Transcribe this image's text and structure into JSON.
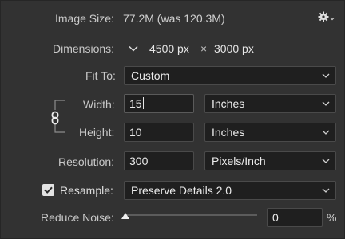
{
  "image_size": {
    "label": "Image Size:",
    "value": "77.2M (was 120.3M)"
  },
  "gear": {
    "icon": "gear-icon"
  },
  "dimensions": {
    "label": "Dimensions:",
    "width": "4500 px",
    "times": "×",
    "height": "3000 px"
  },
  "fit_to": {
    "label": "Fit To:",
    "value": "Custom"
  },
  "width": {
    "label": "Width:",
    "value": "15",
    "unit": "Inches"
  },
  "height": {
    "label": "Height:",
    "value": "10",
    "unit": "Inches"
  },
  "link": {
    "icon": "chain-link-icon"
  },
  "resolution": {
    "label": "Resolution:",
    "value": "300",
    "unit": "Pixels/Inch"
  },
  "resample": {
    "label": "Resample:",
    "checked": true,
    "value": "Preserve Details 2.0"
  },
  "reduce_noise": {
    "label": "Reduce Noise:",
    "value": "0",
    "unit": "%",
    "level": 0
  }
}
